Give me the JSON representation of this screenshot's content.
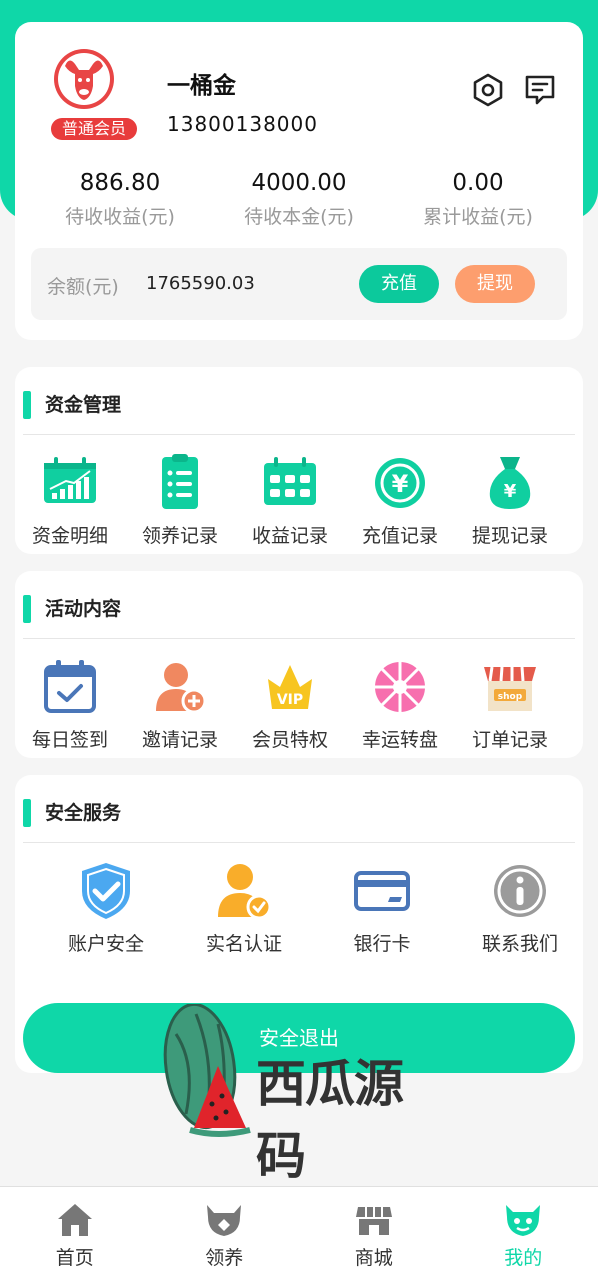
{
  "profile": {
    "username": "一桶金",
    "phone": "13800138000",
    "member_level": "普通会员",
    "settings_icon": "settings-hexagon-icon",
    "message_icon": "message-icon"
  },
  "stats": [
    {
      "value": "886.80",
      "label": "待收收益(元)"
    },
    {
      "value": "4000.00",
      "label": "待收本金(元)"
    },
    {
      "value": "0.00",
      "label": "累计收益(元)"
    }
  ],
  "balance": {
    "label": "余额(元)",
    "value": "1765590.03",
    "recharge_label": "充值",
    "withdraw_label": "提现"
  },
  "fund_section": {
    "title": "资金管理",
    "items": [
      {
        "label": "资金明细",
        "icon": "chart-icon"
      },
      {
        "label": "领养记录",
        "icon": "clipboard-icon"
      },
      {
        "label": "收益记录",
        "icon": "calendar-grid-icon"
      },
      {
        "label": "充值记录",
        "icon": "yen-coin-icon"
      },
      {
        "label": "提现记录",
        "icon": "money-bag-icon"
      }
    ]
  },
  "activity_section": {
    "title": "活动内容",
    "items": [
      {
        "label": "每日签到",
        "icon": "calendar-check-icon"
      },
      {
        "label": "邀请记录",
        "icon": "add-user-icon"
      },
      {
        "label": "会员特权",
        "icon": "vip-crown-icon"
      },
      {
        "label": "幸运转盘",
        "icon": "wheel-icon"
      },
      {
        "label": "订单记录",
        "icon": "shop-icon"
      }
    ]
  },
  "security_section": {
    "title": "安全服务",
    "items": [
      {
        "label": "账户安全",
        "icon": "shield-check-icon"
      },
      {
        "label": "实名认证",
        "icon": "user-verified-icon"
      },
      {
        "label": "银行卡",
        "icon": "bank-card-icon"
      },
      {
        "label": "联系我们",
        "icon": "info-icon"
      }
    ]
  },
  "logout_label": "安全退出",
  "watermark_text": "西瓜源码",
  "nav": [
    {
      "label": "首页",
      "icon": "home-icon",
      "active": false
    },
    {
      "label": "领养",
      "icon": "bull-icon",
      "active": false
    },
    {
      "label": "商城",
      "icon": "store-icon",
      "active": false
    },
    {
      "label": "我的",
      "icon": "bull-face-icon",
      "active": true
    }
  ],
  "colors": {
    "accent": "#0fd7a8",
    "withdraw": "#fd9e6e",
    "badge": "#e83c3c"
  }
}
